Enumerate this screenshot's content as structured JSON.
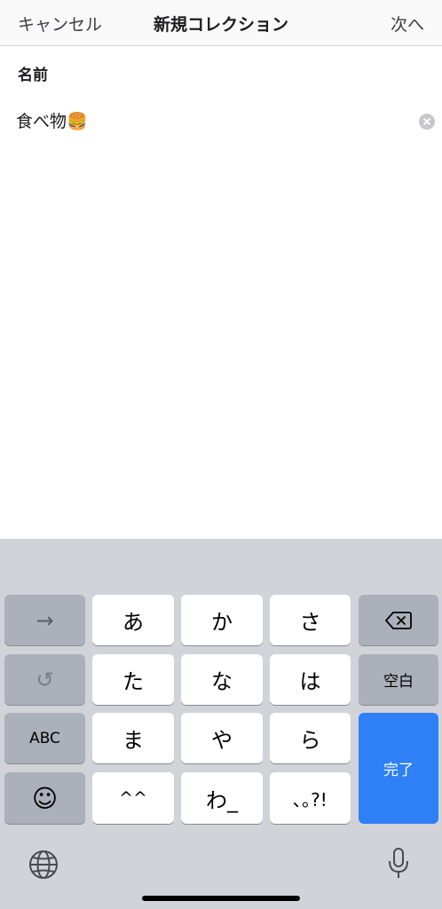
{
  "nav": {
    "cancel": "キャンセル",
    "title": "新規コレクション",
    "next": "次へ"
  },
  "form": {
    "name_label": "名前",
    "name_value": "食べ物🍔"
  },
  "keyboard": {
    "row1": [
      "あ",
      "か",
      "さ"
    ],
    "row2": [
      "た",
      "な",
      "は"
    ],
    "row3": [
      "ま",
      "や",
      "ら"
    ],
    "row4": [
      "^^",
      "わ_",
      "､｡?!"
    ],
    "abc_label": "ABC",
    "space_label": "空白",
    "done_label": "完了",
    "arrow_symbol": "→",
    "undo_symbol": "↺",
    "emoji_symbol": "☺",
    "icons": [
      "arrow-right-icon",
      "undo-icon",
      "emoji-icon",
      "backspace-icon",
      "globe-icon",
      "microphone-icon"
    ]
  },
  "colors": {
    "done_key": "#2f80f6",
    "keyboard_bg": "#d1d3d9",
    "gray_key": "#abb0ba"
  }
}
